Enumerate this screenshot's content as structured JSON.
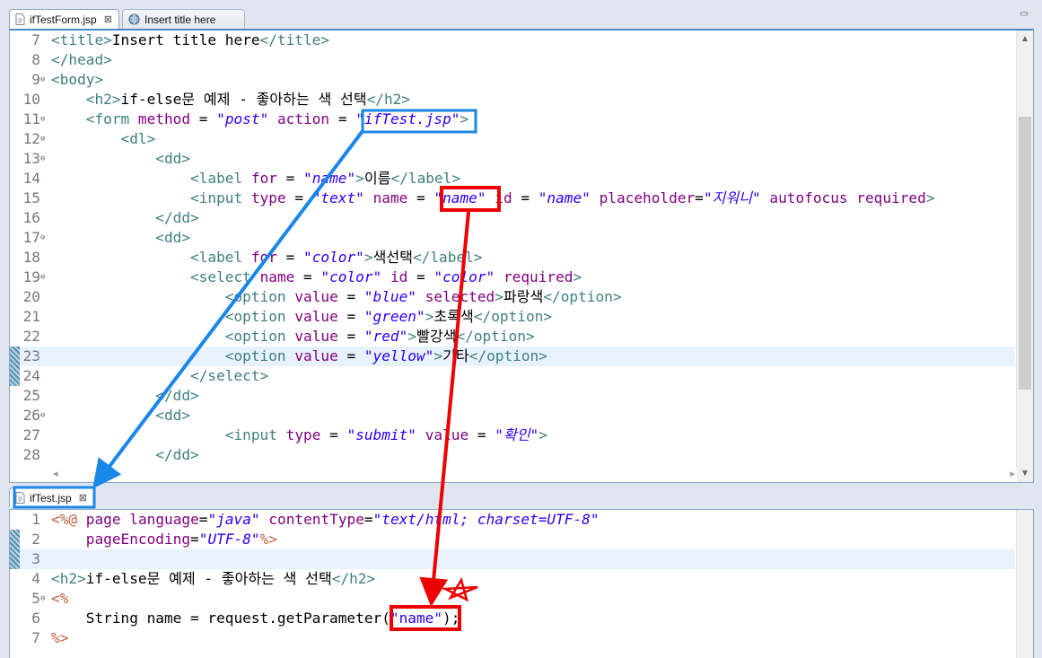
{
  "editor_top": {
    "tabs": [
      {
        "label": "ifTestForm.jsp",
        "close": "⊠"
      },
      {
        "label": "Insert title here"
      }
    ],
    "lines": [
      {
        "num": "7",
        "fold": "",
        "html": "<span class='t'>&lt;title&gt;</span>Insert title here<span class='t'>&lt;/title&gt;</span>"
      },
      {
        "num": "8",
        "fold": "",
        "html": "<span class='t'>&lt;/head&gt;</span>"
      },
      {
        "num": "9",
        "fold": "⊖",
        "html": "<span class='t'>&lt;body&gt;</span>"
      },
      {
        "num": "10",
        "fold": "",
        "html": "    <span class='t'>&lt;h2&gt;</span>if-else문 예제 - 좋아하는 색 선택<span class='t'>&lt;/h2&gt;</span>"
      },
      {
        "num": "11",
        "fold": "⊖",
        "html": "    <span class='t'>&lt;form</span> <span class='a'>method</span> = <span class='v'>\"post\"</span> <span class='a'>action</span> = <span class='v'>\"ifTest.jsp\"</span><span class='t'>&gt;</span>"
      },
      {
        "num": "12",
        "fold": "⊖",
        "html": "        <span class='t'>&lt;dl&gt;</span>"
      },
      {
        "num": "13",
        "fold": "⊖",
        "html": "            <span class='t'>&lt;dd&gt;</span>"
      },
      {
        "num": "14",
        "fold": "",
        "html": "                <span class='t'>&lt;label</span> <span class='a'>for</span> = <span class='v'>\"name\"</span><span class='t'>&gt;</span>이름<span class='t'>&lt;/label&gt;</span>"
      },
      {
        "num": "15",
        "fold": "",
        "html": "                <span class='t'>&lt;input</span> <span class='a'>type</span> = <span class='v'>\"text\"</span> <span class='a'>name</span> = <span class='v'>\"name\"</span> <span class='a'>id</span> = <span class='v'>\"name\"</span> <span class='a'>placeholder</span>=<span class='v'>\"지워니\"</span> <span class='a'>autofocus</span> <span class='a'>required</span><span class='t'>&gt;</span>"
      },
      {
        "num": "16",
        "fold": "",
        "html": "            <span class='t'>&lt;/dd&gt;</span>"
      },
      {
        "num": "17",
        "fold": "⊖",
        "html": "            <span class='t'>&lt;dd&gt;</span>"
      },
      {
        "num": "18",
        "fold": "",
        "html": "                <span class='t'>&lt;label</span> <span class='a'>for</span> = <span class='v'>\"color\"</span><span class='t'>&gt;</span>색선택<span class='t'>&lt;/label&gt;</span>"
      },
      {
        "num": "19",
        "fold": "⊖",
        "html": "                <span class='t'>&lt;select</span> <span class='a'>name</span> = <span class='v'>\"color\"</span> <span class='a'>id</span> = <span class='v'>\"color\"</span> <span class='a'>required</span><span class='t'>&gt;</span>"
      },
      {
        "num": "20",
        "fold": "",
        "html": "                    <span class='t'>&lt;option</span> <span class='a'>value</span> = <span class='v'>\"blue\"</span> <span class='a'>selected</span><span class='t'>&gt;</span>파랑색<span class='t'>&lt;/option&gt;</span>"
      },
      {
        "num": "21",
        "fold": "",
        "html": "                    <span class='t'>&lt;option</span> <span class='a'>value</span> = <span class='v'>\"green\"</span><span class='t'>&gt;</span>초록색<span class='t'>&lt;/option&gt;</span>"
      },
      {
        "num": "22",
        "fold": "",
        "html": "                    <span class='t'>&lt;option</span> <span class='a'>value</span> = <span class='v'>\"red\"</span><span class='t'>&gt;</span>빨강색<span class='t'>&lt;/option&gt;</span>"
      },
      {
        "num": "23",
        "fold": "",
        "html": "                    <span class='t'>&lt;option</span> <span class='a'>value</span> = <span class='v'>\"yellow\"</span><span class='t'>&gt;</span>기타<span class='t'>&lt;/option&gt;</span>",
        "current": true
      },
      {
        "num": "24",
        "fold": "",
        "html": "                <span class='t'>&lt;/select&gt;</span>"
      },
      {
        "num": "25",
        "fold": "",
        "html": "            <span class='t'>&lt;/dd&gt;</span>"
      },
      {
        "num": "26",
        "fold": "⊖",
        "html": "            <span class='t'>&lt;dd&gt;</span>"
      },
      {
        "num": "27",
        "fold": "",
        "html": "                    <span class='t'>&lt;input</span> <span class='a'>type</span> = <span class='v'>\"submit\"</span> <span class='a'>value</span> = <span class='v'>\"확인\"</span><span class='t'>&gt;</span>"
      },
      {
        "num": "28",
        "fold": "",
        "html": "            <span class='t'>&lt;/dd&gt;</span>"
      }
    ]
  },
  "editor_bottom": {
    "tabs": [
      {
        "label": "ifTest.jsp",
        "close": "⊠"
      }
    ],
    "lines": [
      {
        "num": "1",
        "fold": "",
        "html": "<span class='k'>&lt;%@</span> <span class='a'>page</span> <span class='a'>language</span>=<span class='v'>\"java\"</span> <span class='a'>contentType</span>=<span class='v'>\"text/html; charset=UTF-8\"</span>"
      },
      {
        "num": "2",
        "fold": "",
        "html": "    <span class='a'>pageEncoding</span>=<span class='v'>\"UTF-8\"</span><span class='k'>%&gt;</span>"
      },
      {
        "num": "3",
        "fold": "",
        "html": "",
        "current": true
      },
      {
        "num": "4",
        "fold": "",
        "html": "<span class='t'>&lt;h2&gt;</span>if-else문 예제 - 좋아하는 색 선택<span class='t'>&lt;/h2&gt;</span>"
      },
      {
        "num": "5",
        "fold": "⊖",
        "html": "<span class='k'>&lt;%</span>"
      },
      {
        "num": "6",
        "fold": "",
        "html": "    String name = request.getParameter(<span class='s'>\"name\"</span>);"
      },
      {
        "num": "7",
        "fold": "",
        "html": "<span class='k'>%&gt;</span>"
      }
    ]
  },
  "scrollbar": {
    "up": "▲",
    "down": "▼",
    "left": "◂",
    "right": "▸"
  },
  "colors": {
    "annotation_blue": "#1a87e8",
    "annotation_red": "#ee0000"
  }
}
